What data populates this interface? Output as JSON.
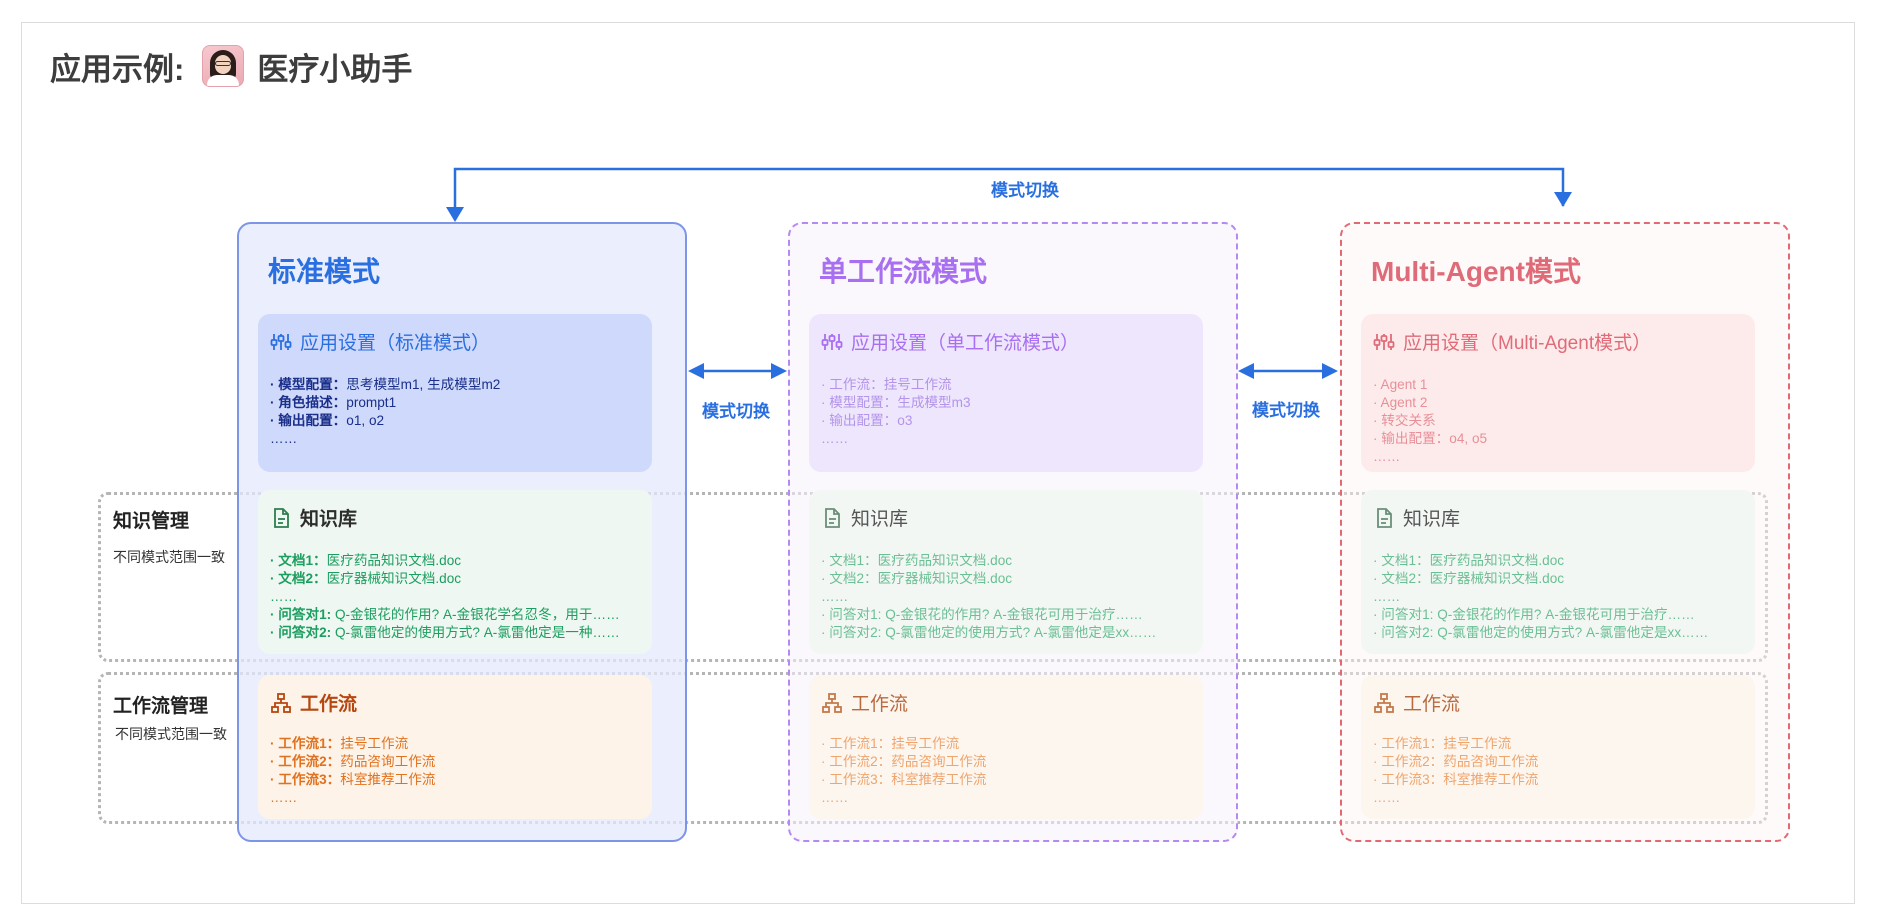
{
  "header": {
    "prefix": "应用示例:",
    "app_name": "医疗小助手"
  },
  "bands": {
    "knowledge": {
      "title": "知识管理",
      "subtitle": "不同模式范围一致"
    },
    "workflow": {
      "title": "工作流管理",
      "subtitle": "不同模式范围一致"
    }
  },
  "switch_label": "模式切换",
  "colors": {
    "blue": "#2a6fe0",
    "purple": "#a86ff0",
    "red": "#e06b78",
    "green": "#1c9e5f",
    "orange": "#e2711d"
  },
  "columns": [
    {
      "title": "标准模式",
      "settings": {
        "title": "应用设置（标准模式）",
        "items": [
          {
            "key": "· 模型配置：",
            "val": "思考模型m1, 生成模型m2"
          },
          {
            "key": "· 角色描述：",
            "val": "prompt1"
          },
          {
            "key": "· 输出配置：",
            "val": "o1, o2"
          },
          {
            "key": "",
            "val": "……"
          }
        ]
      },
      "kb": {
        "title": "知识库",
        "items": [
          {
            "key": "· 文档1：",
            "val": "医疗药品知识文档.doc"
          },
          {
            "key": "· 文档2：",
            "val": "医疗器械知识文档.doc"
          },
          {
            "key": "",
            "val": "……"
          },
          {
            "key": "· 问答对1: ",
            "val": "Q-金银花的作用? A-金银花学名忍冬，用于……"
          },
          {
            "key": "· 问答对2: ",
            "val": "Q-氯雷他定的使用方式? A-氯雷他定是一种……"
          }
        ]
      },
      "wf": {
        "title": "工作流",
        "items": [
          {
            "key": "· 工作流1：",
            "val": "挂号工作流"
          },
          {
            "key": "· 工作流2：",
            "val": "药品咨询工作流"
          },
          {
            "key": "· 工作流3：",
            "val": "科室推荐工作流"
          },
          {
            "key": "",
            "val": "……"
          }
        ]
      }
    },
    {
      "title": "单工作流模式",
      "settings": {
        "title": "应用设置（单工作流模式）",
        "items": [
          {
            "key": "· 工作流：",
            "val": "挂号工作流"
          },
          {
            "key": "· 模型配置：",
            "val": "生成模型m3"
          },
          {
            "key": "· 输出配置：",
            "val": "o3"
          },
          {
            "key": "",
            "val": "……"
          }
        ]
      },
      "kb": {
        "title": "知识库",
        "items": [
          {
            "key": "· 文档1：",
            "val": "医疗药品知识文档.doc"
          },
          {
            "key": "· 文档2：",
            "val": "医疗器械知识文档.doc"
          },
          {
            "key": "",
            "val": "……"
          },
          {
            "key": "· 问答对1: ",
            "val": "Q-金银花的作用? A-金银花可用于治疗……"
          },
          {
            "key": "· 问答对2: ",
            "val": "Q-氯雷他定的使用方式? A-氯雷他定是xx……"
          }
        ]
      },
      "wf": {
        "title": "工作流",
        "items": [
          {
            "key": "· 工作流1：",
            "val": "挂号工作流"
          },
          {
            "key": "· 工作流2：",
            "val": "药品咨询工作流"
          },
          {
            "key": "· 工作流3：",
            "val": "科室推荐工作流"
          },
          {
            "key": "",
            "val": "……"
          }
        ]
      }
    },
    {
      "title": "Multi-Agent模式",
      "settings": {
        "title": "应用设置（Multi-Agent模式）",
        "items": [
          {
            "key": "· Agent 1",
            "val": ""
          },
          {
            "key": "· Agent 2",
            "val": ""
          },
          {
            "key": "· 转交关系",
            "val": ""
          },
          {
            "key": "· 输出配置：",
            "val": "o4, o5"
          },
          {
            "key": "",
            "val": "……"
          }
        ]
      },
      "kb": {
        "title": "知识库",
        "items": [
          {
            "key": "· 文档1：",
            "val": "医疗药品知识文档.doc"
          },
          {
            "key": "· 文档2：",
            "val": "医疗器械知识文档.doc"
          },
          {
            "key": "",
            "val": "……"
          },
          {
            "key": "· 问答对1: ",
            "val": "Q-金银花的作用? A-金银花可用于治疗……"
          },
          {
            "key": "· 问答对2: ",
            "val": "Q-氯雷他定的使用方式? A-氯雷他定是xx……"
          }
        ]
      },
      "wf": {
        "title": "工作流",
        "items": [
          {
            "key": "· 工作流1：",
            "val": "挂号工作流"
          },
          {
            "key": "· 工作流2：",
            "val": "药品咨询工作流"
          },
          {
            "key": "· 工作流3：",
            "val": "科室推荐工作流"
          },
          {
            "key": "",
            "val": "……"
          }
        ]
      }
    }
  ]
}
